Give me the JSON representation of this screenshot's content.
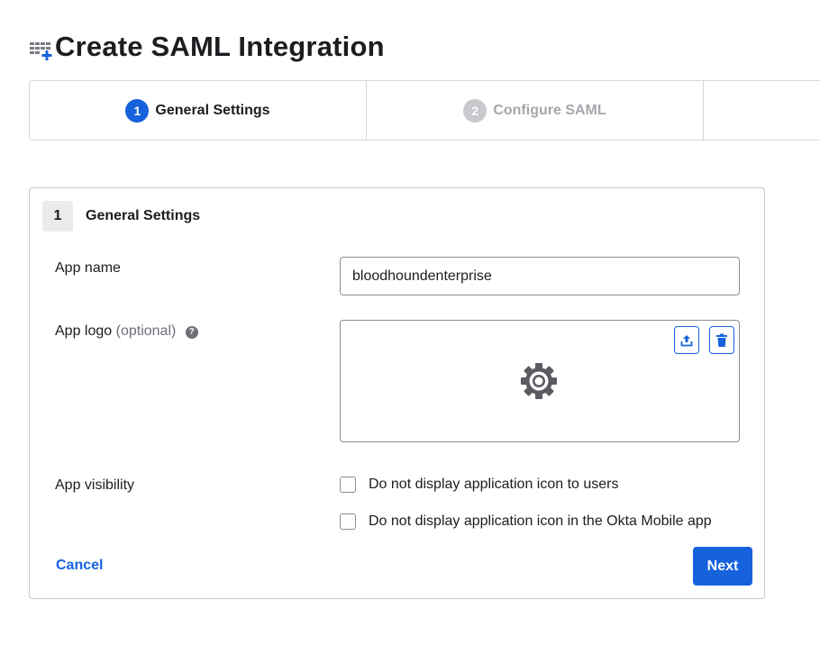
{
  "header": {
    "title": "Create SAML Integration",
    "icon": "app-grid-add-icon"
  },
  "stepper": {
    "steps": [
      {
        "number": "1",
        "label": "General Settings",
        "state": "active"
      },
      {
        "number": "2",
        "label": "Configure SAML",
        "state": "inactive"
      },
      {
        "number": "",
        "label": "",
        "state": "inactive"
      }
    ]
  },
  "section": {
    "number": "1",
    "title": "General Settings"
  },
  "form": {
    "app_name": {
      "label": "App name",
      "value": "bloodhoundenterprise"
    },
    "app_logo": {
      "label": "App logo",
      "optional": "(optional)",
      "help_icon": "?",
      "placeholder_icon": "gear-icon",
      "upload_icon": "upload-icon",
      "delete_icon": "trash-icon"
    },
    "app_visibility": {
      "label": "App visibility",
      "options": [
        {
          "label": "Do not display application icon to users",
          "checked": false
        },
        {
          "label": "Do not display application icon in the Okta Mobile app",
          "checked": false
        }
      ]
    }
  },
  "actions": {
    "cancel_label": "Cancel",
    "next_label": "Next"
  },
  "colors": {
    "primary": "#1662dd",
    "inactive": "#c8c8cd",
    "text": "#1d1d21",
    "border": "#d7d7dc"
  }
}
